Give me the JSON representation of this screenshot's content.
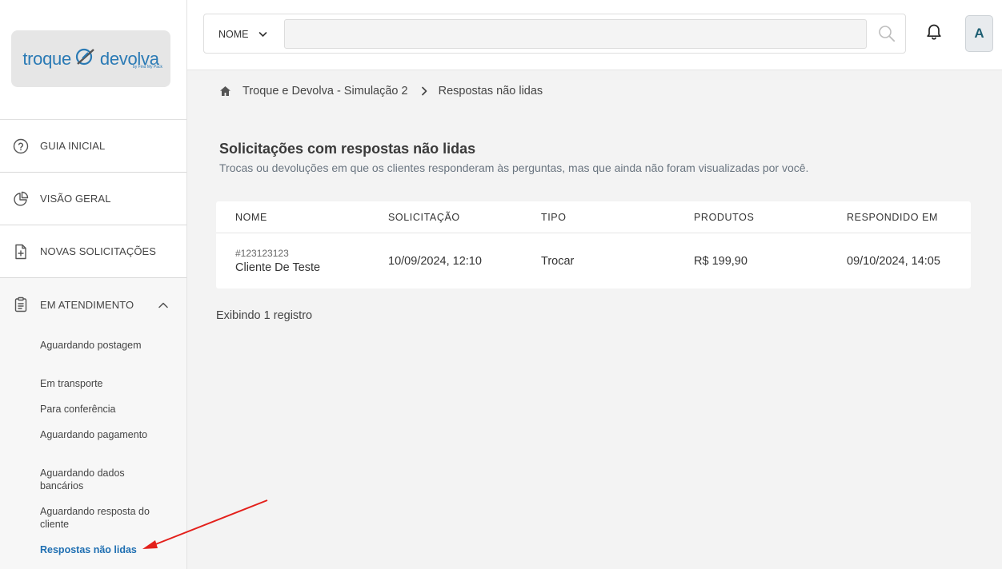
{
  "sidebar": {
    "logo": {
      "brand_left": "troque",
      "brand_right": "devolva",
      "tagline": "by Find My Pack"
    },
    "items": [
      {
        "label": "GUIA INICIAL",
        "icon": "help-circle-icon"
      },
      {
        "label": "VISÃO GERAL",
        "icon": "pie-chart-icon"
      },
      {
        "label": "NOVAS SOLICITAÇÕES",
        "icon": "file-plus-icon"
      },
      {
        "label": "EM ATENDIMENTO",
        "icon": "clipboard-icon",
        "expanded": true
      }
    ],
    "sub_items": [
      {
        "label": "Aguardando postagem"
      },
      {
        "label": "Em transporte"
      },
      {
        "label": "Para conferência"
      },
      {
        "label": "Aguardando pagamento"
      },
      {
        "label": "Aguardando dados bancários"
      },
      {
        "label": "Aguardando resposta do cliente"
      },
      {
        "label": "Respostas não lidas",
        "active": true
      }
    ]
  },
  "topbar": {
    "search_field_select": "NOME",
    "search_value": "",
    "avatar_initial": "A"
  },
  "breadcrumb": {
    "home_icon": "home-icon",
    "parent": "Troque e Devolva - Simulação 2",
    "current": "Respostas não lidas"
  },
  "main": {
    "title": "Solicitações com respostas não lidas",
    "subtitle": "Trocas ou devoluções em que os clientes responderam às perguntas, mas que ainda não foram visualizadas por você.",
    "table": {
      "columns": [
        "NOME",
        "SOLICITAÇÃO",
        "TIPO",
        "PRODUTOS",
        "RESPONDIDO EM"
      ],
      "rows": [
        {
          "id": "#123123123",
          "name": "Cliente De Teste",
          "requested_at": "10/09/2024, 12:10",
          "type": "Trocar",
          "products": "R$ 199,90",
          "answered_at": "09/10/2024, 14:05"
        }
      ]
    },
    "record_count_text": "Exibindo 1 registro"
  },
  "colors": {
    "accent": "#1f6fb2",
    "annotation_arrow": "#e3201b"
  }
}
